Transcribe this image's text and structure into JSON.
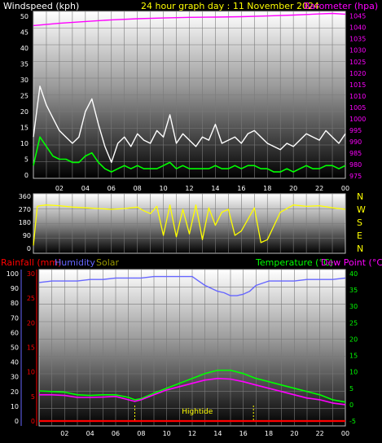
{
  "header": {
    "windspeed_label": "Windspeed (kph)",
    "title": "24 hour graph day : 11 November 2024",
    "barometer_label": "Barometer (hpa)"
  },
  "mid_header": {
    "rainfall_label": "Rainfall (mm)",
    "humidity_label": "Humidity",
    "solar_label": "Solar",
    "temperature_label": "Temperature (°C)",
    "dewpoint_label": "Dew Point (°C)"
  },
  "colors": {
    "title": "#ffff00",
    "windspeed": "#ffffff",
    "gust": "#ffffff",
    "barometer": "#ff00ff",
    "direction": "#ffff00",
    "rainfall": "#ff0000",
    "humidity": "#6666ff",
    "solar": "#999900",
    "temperature": "#00ff00",
    "dewpoint": "#ff00ff",
    "hightide": "#ffff00"
  },
  "chart_data": [
    {
      "type": "line",
      "name": "wind-barometer",
      "x_ticks": [
        "02",
        "04",
        "06",
        "08",
        "10",
        "12",
        "14",
        "16",
        "18",
        "20",
        "22",
        "00"
      ],
      "x_range_hours": [
        0,
        24
      ],
      "y_left": {
        "label": "Windspeed (kph)",
        "ticks": [
          0,
          5,
          10,
          15,
          20,
          25,
          30,
          35,
          40,
          45,
          50
        ],
        "range": [
          0,
          50
        ]
      },
      "y_right": {
        "label": "Barometer (hpa)",
        "ticks": [
          975,
          980,
          985,
          990,
          995,
          1000,
          1005,
          1010,
          1015,
          1020,
          1025,
          1030,
          1035,
          1040,
          1045
        ],
        "range": [
          974,
          1047
        ]
      },
      "series": [
        {
          "key": "barometer",
          "hours": [
            0,
            2,
            4,
            6,
            8,
            10,
            12,
            14,
            16,
            18,
            20,
            22,
            23,
            24
          ],
          "values": [
            1040.8,
            1041.8,
            1042.6,
            1043.3,
            1043.8,
            1044.1,
            1044.4,
            1044.5,
            1044.7,
            1045.0,
            1045.4,
            1045.9,
            1046.1,
            1045.8
          ]
        },
        {
          "key": "gust",
          "hours": [
            0,
            0.5,
            1,
            1.5,
            2,
            2.5,
            3,
            3.5,
            4,
            4.5,
            5,
            5.5,
            6,
            6.5,
            7,
            7.5,
            8,
            8.5,
            9,
            9.5,
            10,
            10.5,
            11,
            11.5,
            12,
            12.5,
            13,
            13.5,
            14,
            14.5,
            15,
            15.5,
            16,
            16.5,
            17,
            17.5,
            18,
            18.5,
            19,
            19.5,
            20,
            20.5,
            21,
            21.5,
            22,
            22.5,
            23,
            23.5,
            24
          ],
          "values": [
            12,
            28,
            22,
            18,
            14,
            12,
            10,
            12,
            20,
            24,
            16,
            9,
            4,
            10,
            12,
            9,
            13,
            11,
            10,
            14,
            12,
            19,
            10,
            13,
            11,
            9,
            12,
            11,
            16,
            10,
            11,
            12,
            10,
            13,
            14,
            12,
            10,
            9,
            8,
            10,
            9,
            11,
            13,
            12,
            11,
            14,
            12,
            10,
            13
          ]
        },
        {
          "key": "windspeed",
          "hours": [
            0,
            0.5,
            1,
            1.5,
            2,
            2.5,
            3,
            3.5,
            4,
            4.5,
            5,
            5.5,
            6,
            6.5,
            7,
            7.5,
            8,
            8.5,
            9,
            9.5,
            10,
            10.5,
            11,
            11.5,
            12,
            12.5,
            13,
            13.5,
            14,
            14.5,
            15,
            15.5,
            16,
            16.5,
            17,
            17.5,
            18,
            18.5,
            19,
            19.5,
            20,
            20.5,
            21,
            21.5,
            22,
            22.5,
            23,
            23.5,
            24
          ],
          "values": [
            3,
            12,
            9,
            6,
            5,
            5,
            4,
            4,
            6,
            7,
            4,
            2,
            1,
            2,
            3,
            2,
            3,
            2,
            2,
            2,
            3,
            4,
            2,
            3,
            2,
            2,
            2,
            2,
            3,
            2,
            2,
            3,
            2,
            3,
            3,
            2,
            2,
            1,
            1,
            2,
            1,
            2,
            3,
            2,
            2,
            3,
            3,
            2,
            3
          ]
        }
      ]
    },
    {
      "type": "line",
      "name": "wind-direction",
      "x_range_hours": [
        0,
        24
      ],
      "y_left": {
        "ticks": [
          0,
          90,
          180,
          270,
          360
        ],
        "range": [
          0,
          360
        ]
      },
      "y_right": {
        "ticks": [
          "N",
          "W",
          "S",
          "E",
          "N"
        ]
      },
      "series": [
        {
          "key": "direction",
          "hours": [
            0,
            0.3,
            0.5,
            1,
            2,
            3,
            4,
            5,
            6,
            7,
            8,
            8.5,
            9,
            9.5,
            10,
            10.5,
            11,
            11.5,
            12,
            12.5,
            13,
            13.5,
            14,
            14.5,
            15,
            15.5,
            16,
            17,
            17.5,
            18,
            19,
            20,
            21,
            22,
            23,
            24
          ],
          "values": [
            20,
            290,
            295,
            300,
            295,
            285,
            280,
            275,
            270,
            275,
            285,
            260,
            240,
            290,
            90,
            300,
            80,
            270,
            100,
            300,
            60,
            280,
            160,
            250,
            270,
            90,
            120,
            280,
            40,
            60,
            250,
            300,
            290,
            295,
            280,
            270
          ]
        }
      ]
    },
    {
      "type": "line",
      "name": "rain-humidity-temperature",
      "x_ticks": [
        "02",
        "04",
        "06",
        "08",
        "10",
        "12",
        "14",
        "16",
        "18",
        "20",
        "22",
        "00"
      ],
      "x_range_hours": [
        0,
        24
      ],
      "y_left_outer": {
        "label": "Humidity",
        "ticks": [
          0,
          10,
          20,
          30,
          40,
          50,
          60,
          70,
          80,
          90,
          100
        ],
        "range": [
          0,
          100
        ]
      },
      "y_left_inner": {
        "label": "Rainfall (mm)",
        "ticks": [
          0,
          5,
          10,
          15,
          20,
          25,
          30
        ],
        "range": [
          0,
          30
        ]
      },
      "y_right": {
        "label": "Temperature (°C)",
        "ticks": [
          -5,
          0,
          5,
          10,
          15,
          20,
          25,
          30,
          35,
          40
        ],
        "range": [
          -5,
          40
        ]
      },
      "annotations": [
        {
          "text": "Hightide",
          "hours": [
            7.5,
            16.8
          ]
        }
      ],
      "series": [
        {
          "key": "humidity",
          "hours": [
            0,
            1,
            2,
            3,
            4,
            5,
            6,
            7,
            8,
            9,
            10,
            11,
            12,
            12.5,
            13,
            13.5,
            14,
            14.5,
            15,
            15.5,
            16,
            16.5,
            17,
            18,
            19,
            20,
            21,
            22,
            23,
            24
          ],
          "values": [
            94,
            95,
            95,
            95,
            96,
            96,
            97,
            97,
            97,
            98,
            98,
            98,
            98,
            95,
            92,
            90,
            88,
            87,
            85,
            85,
            86,
            88,
            92,
            95,
            95,
            95,
            96,
            96,
            96,
            97
          ]
        },
        {
          "key": "temperature",
          "hours": [
            0,
            1,
            2,
            3,
            4,
            5,
            6,
            7,
            7.5,
            8,
            9,
            10,
            11,
            12,
            13,
            14,
            15,
            16,
            17,
            18,
            19,
            20,
            21,
            22,
            23,
            24
          ],
          "values": [
            4.2,
            4.0,
            3.8,
            3.0,
            2.8,
            3.0,
            3.0,
            2.2,
            1.5,
            1.8,
            3.5,
            5.0,
            6.5,
            8.0,
            9.5,
            10.5,
            10.5,
            9.5,
            8.0,
            7.0,
            6.0,
            5.0,
            4.0,
            3.0,
            1.5,
            0.8
          ]
        },
        {
          "key": "dewpoint",
          "hours": [
            0,
            1,
            2,
            3,
            4,
            5,
            6,
            7,
            7.5,
            8,
            9,
            10,
            11,
            12,
            13,
            14,
            15,
            16,
            17,
            18,
            19,
            20,
            21,
            22,
            23,
            24
          ],
          "values": [
            3.0,
            3.0,
            2.8,
            2.2,
            2.2,
            2.3,
            2.5,
            1.5,
            1.0,
            1.5,
            3.0,
            4.5,
            5.5,
            6.5,
            7.5,
            8.0,
            7.8,
            7.0,
            6.0,
            5.0,
            4.0,
            3.0,
            2.0,
            1.5,
            0.5,
            0.0
          ]
        },
        {
          "key": "rainfall",
          "hours": [
            0,
            24
          ],
          "values": [
            0,
            0
          ]
        }
      ]
    }
  ]
}
